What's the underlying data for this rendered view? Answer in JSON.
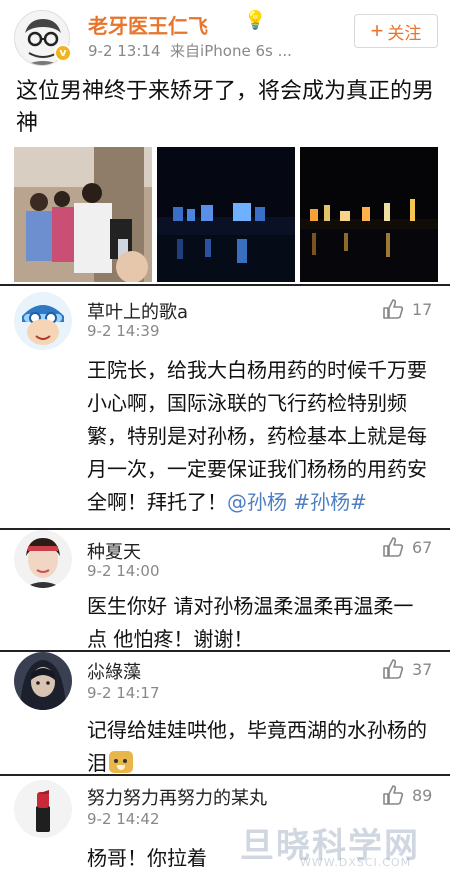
{
  "post": {
    "author": "老牙医王仁飞",
    "time": "9-2 13:14",
    "source": "来自iPhone 6s ...",
    "follow_label": "关注",
    "text": "这位男神终于来矫牙了，将会成为真正的男神"
  },
  "comments": [
    {
      "name": "草叶上的歌a",
      "time": "9-2 14:39",
      "likes": "17",
      "text": "王院长，给我大白杨用药的时候千万要小心啊，国际泳联的飞行药检特别频繁，特别是对孙杨，药检基本上就是每月一次，一定要保证我们杨杨的用药安全啊！拜托了！",
      "mention": "@孙杨",
      "topic": "#孙杨#"
    },
    {
      "name": "种夏天",
      "time": "9-2 14:00",
      "likes": "67",
      "text": "医生你好 请对孙杨温柔温柔再温柔一点 他怕疼！谢谢！"
    },
    {
      "name": "尛綠藻",
      "time": "9-2 14:17",
      "likes": "37",
      "text": "记得给娃娃哄他，毕竟西湖的水孙杨的泪"
    },
    {
      "name": "努力努力再努力的某丸",
      "time": "9-2 14:42",
      "likes": "89",
      "text": "杨哥！你拉着"
    }
  ],
  "watermark": {
    "brand": "旦晓科学网",
    "url": "WWW.DXSCI.COM"
  },
  "colors": {
    "author_orange": "#e8752b",
    "link_blue": "#4e7fc0",
    "meta_gray": "#888888"
  }
}
